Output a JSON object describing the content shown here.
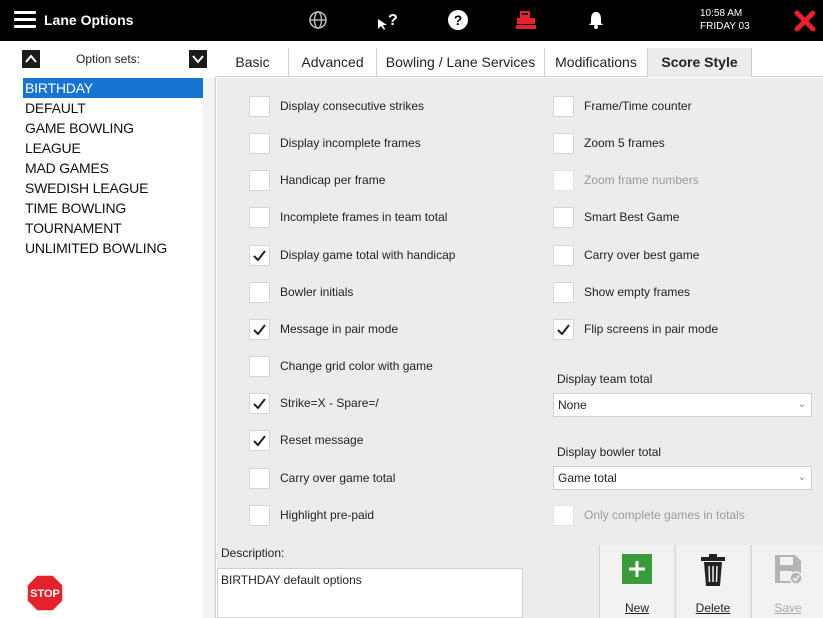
{
  "topbar": {
    "title": "Lane Options",
    "time": "10:58 AM",
    "date": "FRIDAY 03",
    "icons": [
      "menu-icon",
      "globe-icon",
      "help-cursor-icon",
      "help-circle-icon",
      "register-icon",
      "bell-icon",
      "close-icon"
    ]
  },
  "sidebar": {
    "header_label": "Option sets:",
    "items": [
      {
        "label": "BIRTHDAY",
        "selected": true
      },
      {
        "label": "DEFAULT",
        "selected": false
      },
      {
        "label": "GAME BOWLING",
        "selected": false
      },
      {
        "label": "LEAGUE",
        "selected": false
      },
      {
        "label": "MAD GAMES",
        "selected": false
      },
      {
        "label": "SWEDISH LEAGUE",
        "selected": false
      },
      {
        "label": "TIME BOWLING",
        "selected": false
      },
      {
        "label": "TOURNAMENT",
        "selected": false
      },
      {
        "label": "UNLIMITED BOWLING",
        "selected": false
      }
    ],
    "stop_label": "STOP"
  },
  "tabs": [
    {
      "label": "Basic",
      "active": false
    },
    {
      "label": "Advanced",
      "active": false
    },
    {
      "label": "Bowling / Lane Services",
      "active": false
    },
    {
      "label": "Modifications",
      "active": false
    },
    {
      "label": "Score Style",
      "active": true
    }
  ],
  "score_style": {
    "left_options": [
      {
        "label": "Display consecutive strikes",
        "checked": false,
        "enabled": true
      },
      {
        "label": "Display incomplete frames",
        "checked": false,
        "enabled": true
      },
      {
        "label": "Handicap per frame",
        "checked": false,
        "enabled": true
      },
      {
        "label": "Incomplete frames in team total",
        "checked": false,
        "enabled": true
      },
      {
        "label": "Display game total with handicap",
        "checked": true,
        "enabled": true
      },
      {
        "label": "Bowler initials",
        "checked": false,
        "enabled": true
      },
      {
        "label": "Message in pair mode",
        "checked": true,
        "enabled": true
      },
      {
        "label": "Change grid color with game",
        "checked": false,
        "enabled": true
      },
      {
        "label": "Strike=X - Spare=/",
        "checked": true,
        "enabled": true
      },
      {
        "label": "Reset message",
        "checked": true,
        "enabled": true
      },
      {
        "label": "Carry over game total",
        "checked": false,
        "enabled": true
      },
      {
        "label": "Highlight pre-paid",
        "checked": false,
        "enabled": true
      }
    ],
    "right_options": [
      {
        "label": "Frame/Time counter",
        "checked": false,
        "enabled": true
      },
      {
        "label": "Zoom 5 frames",
        "checked": false,
        "enabled": true
      },
      {
        "label": "Zoom frame numbers",
        "checked": false,
        "enabled": false
      },
      {
        "label": "Smart Best Game",
        "checked": false,
        "enabled": true
      },
      {
        "label": "Carry over best game",
        "checked": false,
        "enabled": true
      },
      {
        "label": "Show empty frames",
        "checked": false,
        "enabled": true
      },
      {
        "label": "Flip screens in pair mode",
        "checked": true,
        "enabled": true
      }
    ],
    "team_total": {
      "label": "Display team total",
      "value": "None"
    },
    "bowler_total": {
      "label": "Display bowler total",
      "value": "Game total"
    },
    "only_complete": {
      "label": "Only complete games in totals",
      "checked": false,
      "enabled": false
    }
  },
  "description": {
    "label": "Description:",
    "value": "BIRTHDAY default options"
  },
  "actions": {
    "new_label": "New",
    "delete_label": "Delete",
    "save_label": "Save"
  },
  "colors": {
    "selection": "#1874d2",
    "topbar": "#000000",
    "close": "#e3222b",
    "new_button": "#3a9b3a",
    "panel": "#ececec"
  }
}
